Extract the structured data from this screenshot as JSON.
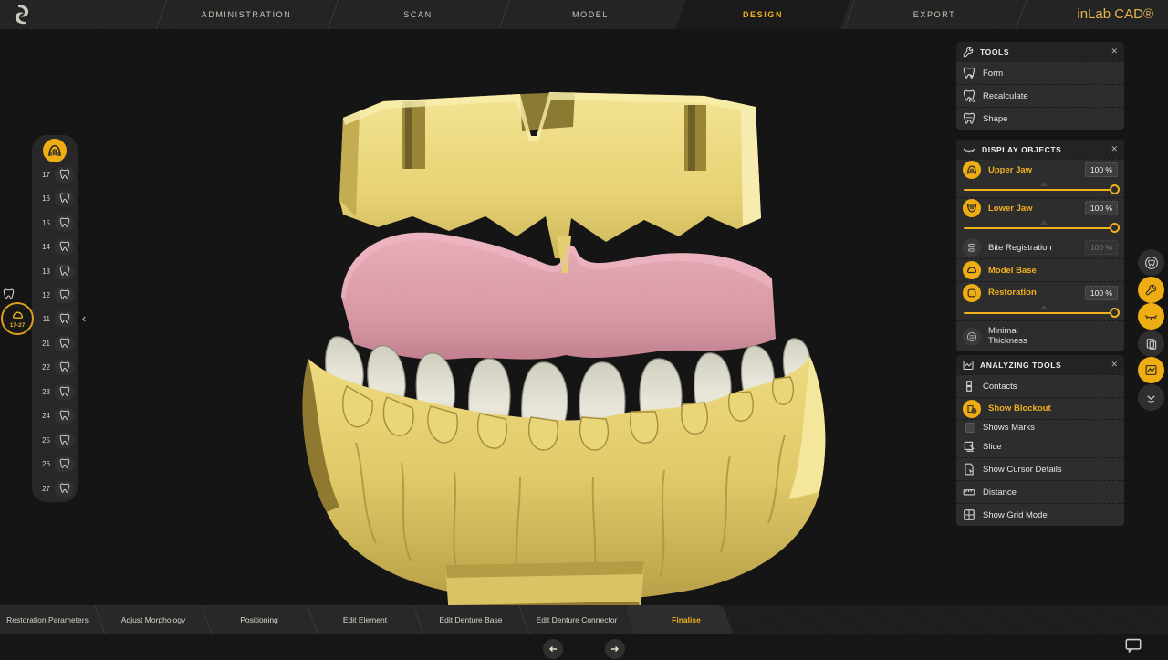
{
  "ui": {
    "close": "✕",
    "collapse": "‹"
  },
  "colors": {
    "accent": "#f0b11e",
    "panel_bg": "#2d2d2d",
    "cast_yellow": "#e9d677",
    "gum_pink": "#dda0ad",
    "teeth_white": "#deddd0"
  },
  "topbar": {
    "brand": "inLab CAD®",
    "tabs": [
      {
        "label": "ADMINISTRATION"
      },
      {
        "label": "SCAN"
      },
      {
        "label": "MODEL"
      },
      {
        "label": "DESIGN"
      },
      {
        "label": "EXPORT"
      }
    ],
    "active_tab": "DESIGN"
  },
  "sidebar": {
    "teeth": [
      "17",
      "16",
      "15",
      "14",
      "13",
      "12",
      "11",
      "21",
      "22",
      "23",
      "24",
      "25",
      "26",
      "27"
    ],
    "badge_label": "17-27"
  },
  "panels": {
    "tools": {
      "title": "TOOLS",
      "items": [
        {
          "label": "Form"
        },
        {
          "label": "Recalculate"
        },
        {
          "label": "Shape"
        }
      ]
    },
    "display_objects": {
      "title": "DISPLAY OBJECTS",
      "upper_jaw": {
        "label": "Upper Jaw",
        "value": "100 %"
      },
      "lower_jaw": {
        "label": "Lower Jaw",
        "value": "100 %"
      },
      "bite_registration": {
        "label": "Bite Registration",
        "value": "100 %"
      },
      "model_base": {
        "label": "Model Base"
      },
      "restoration": {
        "label": "Restoration",
        "value": "100 %"
      },
      "minimal_thickness": {
        "label": "Minimal Thickness"
      }
    },
    "analyzing_tools": {
      "title": "ANALYZING TOOLS",
      "items": [
        {
          "label": "Contacts"
        },
        {
          "label": "Show Blockout"
        },
        {
          "label": "Shows Marks"
        },
        {
          "label": "Slice"
        },
        {
          "label": "Show Cursor Details"
        },
        {
          "label": "Distance"
        },
        {
          "label": "Show Grid Mode"
        }
      ]
    }
  },
  "bottom_bar": {
    "steps": [
      {
        "label": "Restoration Parameters"
      },
      {
        "label": "Adjust Morphology"
      },
      {
        "label": "Positioning"
      },
      {
        "label": "Edit Element"
      },
      {
        "label": "Edit Denture Base"
      },
      {
        "label": "Edit Denture Connector"
      },
      {
        "label": "Finalise"
      }
    ],
    "active_step": "Finalise"
  }
}
